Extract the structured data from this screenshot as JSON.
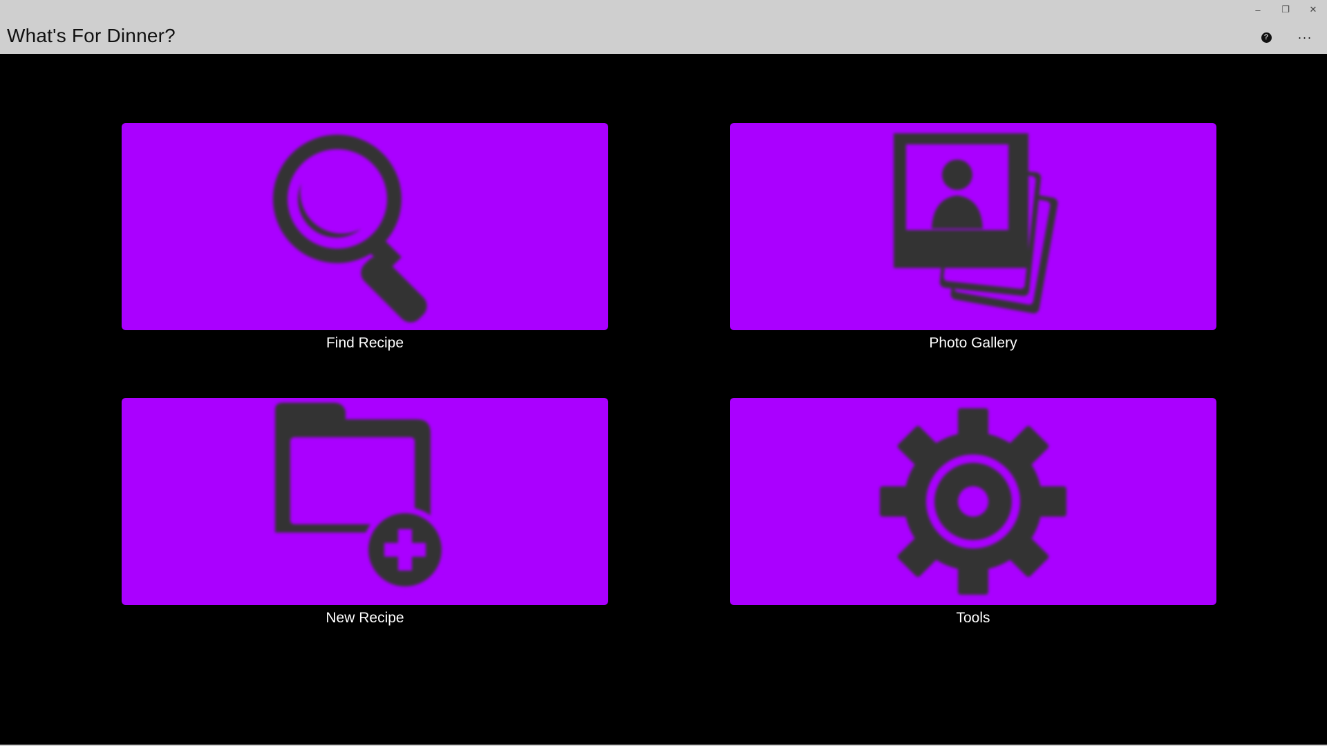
{
  "app": {
    "title": "What's For Dinner?"
  },
  "window_controls": {
    "minimize": "–",
    "restore": "❐",
    "close": "✕"
  },
  "appbar": {
    "help_glyph": "?",
    "more_glyph": "···"
  },
  "colors": {
    "tile_background": "#aa00ff",
    "icon_color": "#333333",
    "chrome_background": "#cfcfcf",
    "content_background": "#000000"
  },
  "tiles": [
    {
      "label": "Find Recipe",
      "icon": "search-icon"
    },
    {
      "label": "Photo Gallery",
      "icon": "photo-gallery-icon"
    },
    {
      "label": "New Recipe",
      "icon": "new-folder-icon"
    },
    {
      "label": "Tools",
      "icon": "gear-icon"
    }
  ]
}
